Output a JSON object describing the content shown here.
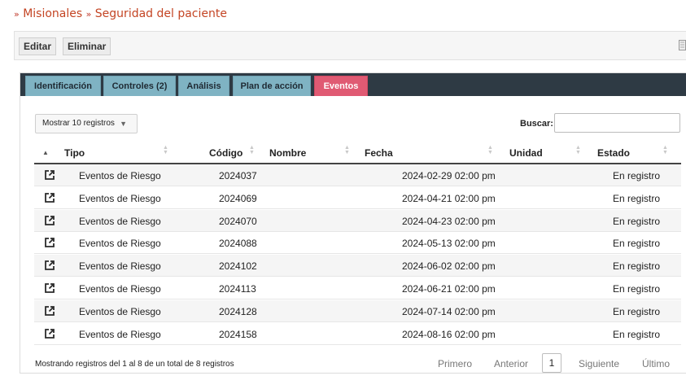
{
  "breadcrumb": {
    "separator": "»",
    "items": [
      "Misionales",
      "Seguridad del paciente"
    ]
  },
  "toolbar": {
    "edit_label": "Editar",
    "delete_label": "Eliminar"
  },
  "tabs": [
    {
      "label": "Identificación",
      "active": false
    },
    {
      "label": "Controles (2)",
      "active": false
    },
    {
      "label": "Análisis",
      "active": false
    },
    {
      "label": "Plan de acción",
      "active": false
    },
    {
      "label": "Eventos",
      "active": true
    }
  ],
  "table": {
    "length_label": "Mostrar 10 registros",
    "search_label": "Buscar:",
    "search_value": "",
    "columns": [
      "Tipo",
      "Código",
      "Nombre",
      "Fecha",
      "Unidad",
      "Estado"
    ],
    "rows": [
      {
        "tipo": "Eventos de Riesgo",
        "codigo": "2024037",
        "nombre": "",
        "fecha": "2024-02-29 02:00 pm",
        "unidad": "",
        "estado": "En registro"
      },
      {
        "tipo": "Eventos de Riesgo",
        "codigo": "2024069",
        "nombre": "",
        "fecha": "2024-04-21 02:00 pm",
        "unidad": "",
        "estado": "En registro"
      },
      {
        "tipo": "Eventos de Riesgo",
        "codigo": "2024070",
        "nombre": "",
        "fecha": "2024-04-23 02:00 pm",
        "unidad": "",
        "estado": "En registro"
      },
      {
        "tipo": "Eventos de Riesgo",
        "codigo": "2024088",
        "nombre": "",
        "fecha": "2024-05-13 02:00 pm",
        "unidad": "",
        "estado": "En registro"
      },
      {
        "tipo": "Eventos de Riesgo",
        "codigo": "2024102",
        "nombre": "",
        "fecha": "2024-06-02 02:00 pm",
        "unidad": "",
        "estado": "En registro"
      },
      {
        "tipo": "Eventos de Riesgo",
        "codigo": "2024113",
        "nombre": "",
        "fecha": "2024-06-21 02:00 pm",
        "unidad": "",
        "estado": "En registro"
      },
      {
        "tipo": "Eventos de Riesgo",
        "codigo": "2024128",
        "nombre": "",
        "fecha": "2024-07-14 02:00 pm",
        "unidad": "",
        "estado": "En registro"
      },
      {
        "tipo": "Eventos de Riesgo",
        "codigo": "2024158",
        "nombre": "",
        "fecha": "2024-08-16 02:00 pm",
        "unidad": "",
        "estado": "En registro"
      }
    ],
    "info": "Mostrando registros del 1 al 8 de un total de 8 registros",
    "pagination": {
      "first": "Primero",
      "previous": "Anterior",
      "current": "1",
      "next": "Siguiente",
      "last": "Último"
    }
  },
  "colors": {
    "accent": "#c44524",
    "tab_bar": "#2e3a44",
    "tab": "#7fb3c3",
    "tab_active": "#e05a73"
  },
  "icons": {
    "row_action": "external-link-icon",
    "sort": "sort-arrows-icon"
  }
}
